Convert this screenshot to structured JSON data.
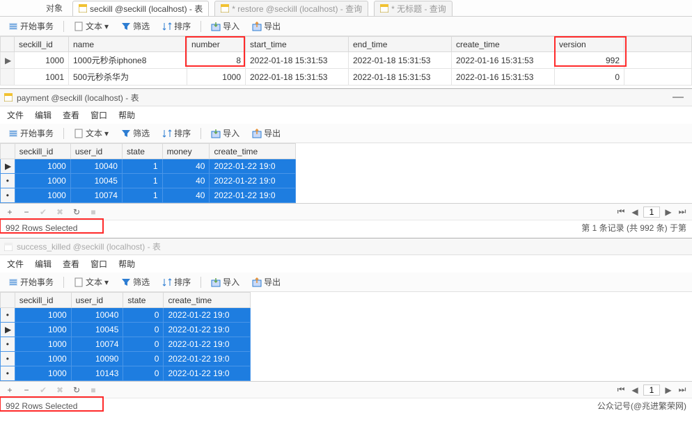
{
  "tabs": {
    "obj_label": "对象",
    "t1": "seckill @seckill (localhost) - 表",
    "t2": "* restore @seckill (localhost) - 查询",
    "t3": "* 无标题 - 查询"
  },
  "toolbar": {
    "begin": "开始事务",
    "text": "文本",
    "filter": "筛选",
    "sort": "排序",
    "import": "导入",
    "export": "导出"
  },
  "menus": {
    "file": "文件",
    "edit": "编辑",
    "view": "查看",
    "window": "窗口",
    "help": "帮助"
  },
  "t1": {
    "cols": [
      "seckill_id",
      "name",
      "number",
      "start_time",
      "end_time",
      "create_time",
      "version"
    ],
    "rows": [
      {
        "mark": "▶",
        "seckill_id": "1000",
        "name": "1000元秒杀iphone8",
        "number": "8",
        "start_time": "2022-01-18 15:31:53",
        "end_time": "2022-01-18 15:31:53",
        "create_time": "2022-01-16 15:31:53",
        "version": "992"
      },
      {
        "mark": "",
        "seckill_id": "1001",
        "name": "500元秒杀华为",
        "number": "1000",
        "start_time": "2022-01-18 15:31:53",
        "end_time": "2022-01-18 15:31:53",
        "create_time": "2022-01-16 15:31:53",
        "version": "0"
      }
    ]
  },
  "pane2": {
    "title": "payment @seckill (localhost) - 表",
    "cols": [
      "seckill_id",
      "user_id",
      "state",
      "money",
      "create_time"
    ],
    "rows": [
      {
        "mark": "▶",
        "seckill_id": "1000",
        "user_id": "10040",
        "state": "1",
        "money": "40",
        "create_time": "2022-01-22 19:0"
      },
      {
        "mark": "•",
        "seckill_id": "1000",
        "user_id": "10045",
        "state": "1",
        "money": "40",
        "create_time": "2022-01-22 19:0"
      },
      {
        "mark": "•",
        "seckill_id": "1000",
        "user_id": "10074",
        "state": "1",
        "money": "40",
        "create_time": "2022-01-22 19:0"
      }
    ],
    "status_left": "992 Rows Selected",
    "status_right": "第 1 条记录 (共 992 条) 于第"
  },
  "pane3": {
    "title": "success_killed @seckill (localhost) - 表",
    "cols": [
      "seckill_id",
      "user_id",
      "state",
      "create_time"
    ],
    "rows": [
      {
        "mark": "•",
        "seckill_id": "1000",
        "user_id": "10040",
        "state": "0",
        "create_time": "2022-01-22 19:0"
      },
      {
        "mark": "▶",
        "seckill_id": "1000",
        "user_id": "10045",
        "state": "0",
        "create_time": "2022-01-22 19:0"
      },
      {
        "mark": "•",
        "seckill_id": "1000",
        "user_id": "10074",
        "state": "0",
        "create_time": "2022-01-22 19:0"
      },
      {
        "mark": "•",
        "seckill_id": "1000",
        "user_id": "10090",
        "state": "0",
        "create_time": "2022-01-22 19:0"
      },
      {
        "mark": "•",
        "seckill_id": "1000",
        "user_id": "10143",
        "state": "0",
        "create_time": "2022-01-22 19:0"
      }
    ],
    "status_left": "992 Rows Selected",
    "status_right": "公众记号(@兆进繁荣网)"
  },
  "nav": {
    "page": "1"
  },
  "watermark": ""
}
